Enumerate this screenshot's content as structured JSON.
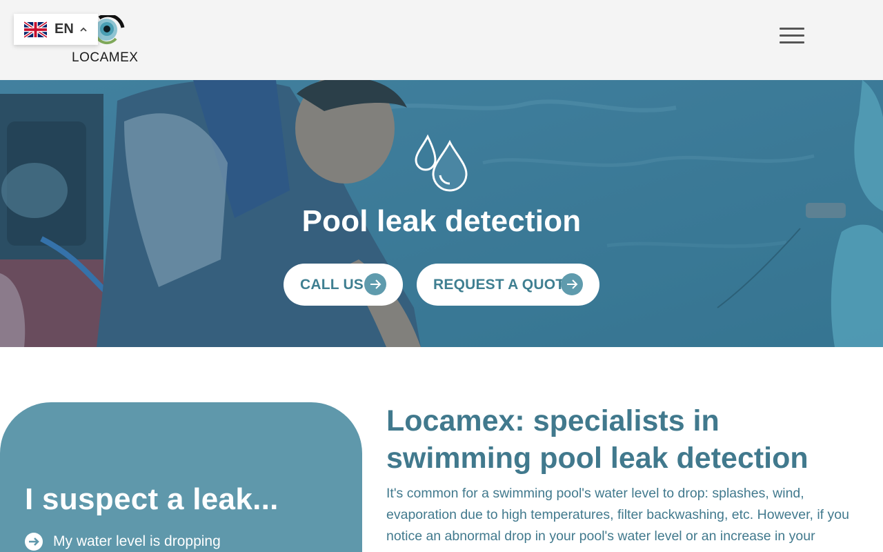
{
  "header": {
    "brand": "LOCAMEX",
    "language": {
      "code": "EN",
      "flag_icon": "uk-flag-icon",
      "caret_icon": "chevron-up-icon"
    },
    "menu_icon": "hamburger-menu-icon"
  },
  "hero": {
    "icon": "water-drops-icon",
    "title": "Pool leak detection",
    "buttons": [
      {
        "label": "CALL US",
        "icon": "arrow-right-icon"
      },
      {
        "label": "REQUEST A QUOTE",
        "icon": "arrow-right-icon"
      }
    ]
  },
  "card": {
    "title": "I suspect a leak...",
    "items": [
      {
        "label": "My water level is dropping",
        "icon": "arrow-circle-right-icon"
      }
    ]
  },
  "intro": {
    "title": "Locamex: specialists in swimming pool leak detection",
    "text": "It's common for a swimming pool's water level to drop: splashes, wind, evaporation due to high temperatures, filter backwashing, etc. However, if you notice an abnormal drop in your pool's water level or an increase in your"
  },
  "colors": {
    "accent": "#41798d",
    "card_bg": "#5f98ab",
    "header_bg": "#f4f4f4",
    "button_arrow_bg": "#5f9bad"
  }
}
